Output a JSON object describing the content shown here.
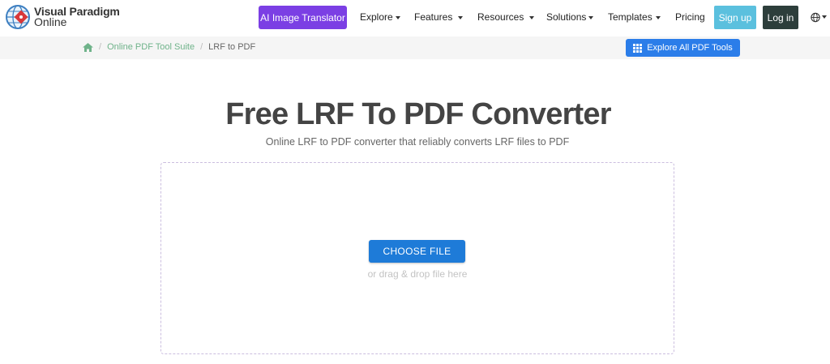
{
  "header": {
    "logo": {
      "line1": "Visual Paradigm",
      "line2": "Online"
    },
    "ai_button": "AI Image Translator",
    "nav": [
      {
        "label": "Explore",
        "caret": true
      },
      {
        "label": "Features",
        "caret": true
      },
      {
        "label": "Resources",
        "caret": true
      },
      {
        "label": "Solutions",
        "caret": true
      },
      {
        "label": "Templates",
        "caret": true
      },
      {
        "label": "Pricing",
        "caret": false
      }
    ],
    "signup": "Sign up",
    "login": "Log in",
    "language_icon": "globe-icon"
  },
  "breadcrumb": {
    "home_icon": "home-icon",
    "items": [
      "Online PDF Tool Suite",
      "LRF to PDF"
    ],
    "separator": "/"
  },
  "explore_button": "Explore All PDF Tools",
  "main": {
    "title": "Free LRF To PDF Converter",
    "subtitle": "Online LRF to PDF converter that reliably converts LRF files to PDF",
    "choose_button": "CHOOSE FILE",
    "drag_text": "or drag & drop file here"
  },
  "colors": {
    "ai_button": "#7b3fe4",
    "signup": "#5bc0de",
    "login": "#2d3e3b",
    "breadcrumb_link": "#6fb38a",
    "explore_button": "#2b7de9",
    "choose_button": "#1e7bd8"
  }
}
